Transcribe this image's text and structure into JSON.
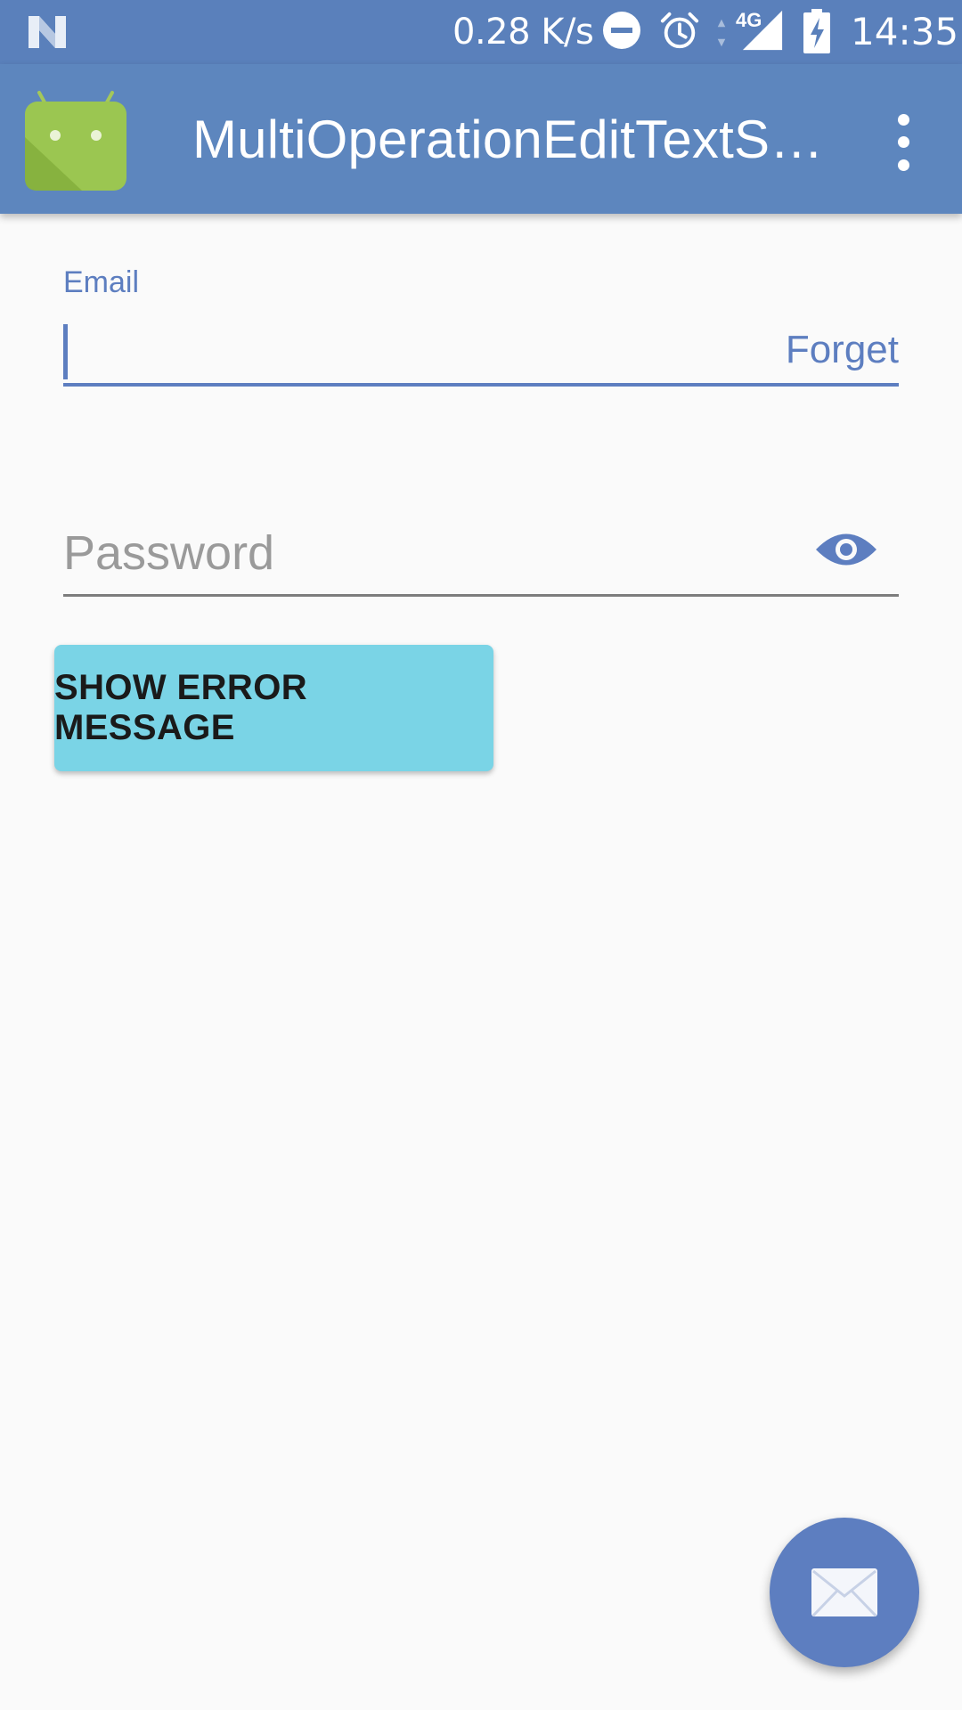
{
  "status_bar": {
    "net_speed": "0.28 K/s",
    "network_type": "4G",
    "time": "14:35",
    "icons": [
      "notification-n-icon",
      "do-not-disturb-icon",
      "alarm-icon",
      "data-arrows-icon",
      "signal-icon",
      "battery-charging-icon"
    ]
  },
  "app_bar": {
    "title": "MultiOperationEditTextS…",
    "icons": [
      "android-app-icon",
      "overflow-menu-icon"
    ]
  },
  "form": {
    "email_label": "Email",
    "email_value": "",
    "email_action": "Forget",
    "password_placeholder": "Password",
    "password_toggle_icon": "eye-icon"
  },
  "button": {
    "label": "SHOW ERROR MESSAGE"
  },
  "fab": {
    "icon": "email-icon"
  },
  "colors": {
    "status_bar": "#5a80bb",
    "app_bar": "#5d86be",
    "accent": "#5d7ec0",
    "button": "#7ad4e6",
    "background": "#fafafa"
  }
}
